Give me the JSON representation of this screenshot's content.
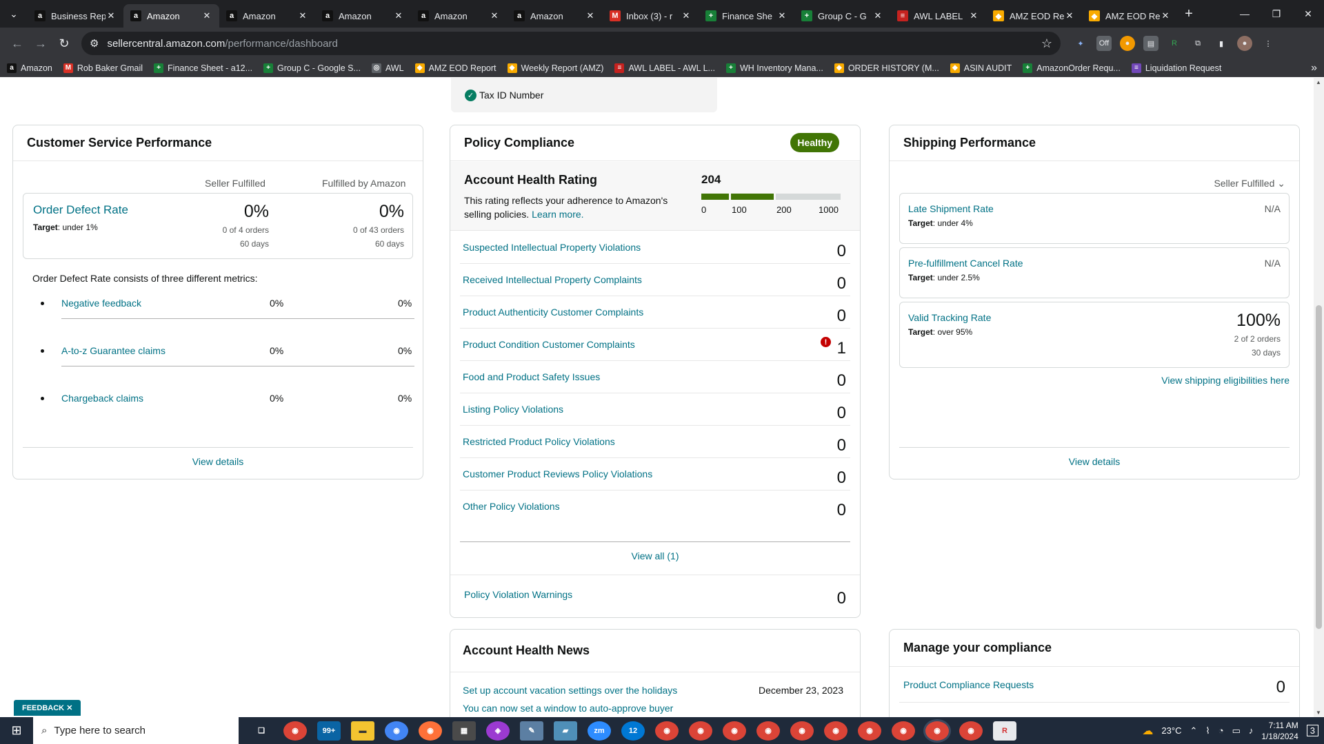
{
  "browser": {
    "tabs": [
      {
        "title": "Business Rep",
        "fav": "a",
        "color": "#111111"
      },
      {
        "title": "Amazon",
        "fav": "a",
        "color": "#111111",
        "active": true
      },
      {
        "title": "Amazon",
        "fav": "a",
        "color": "#111111"
      },
      {
        "title": "Amazon",
        "fav": "a",
        "color": "#111111"
      },
      {
        "title": "Amazon",
        "fav": "a",
        "color": "#111111"
      },
      {
        "title": "Amazon",
        "fav": "a",
        "color": "#111111"
      },
      {
        "title": "Inbox (3) - r",
        "fav": "M",
        "color": "#d93025"
      },
      {
        "title": "Finance She",
        "fav": "+",
        "color": "#188038"
      },
      {
        "title": "Group C - G",
        "fav": "+",
        "color": "#188038"
      },
      {
        "title": "AWL LABEL ",
        "fav": "≡",
        "color": "#c5221f"
      },
      {
        "title": "AMZ EOD Re",
        "fav": "◆",
        "color": "#f9ab00"
      },
      {
        "title": "AMZ EOD Re",
        "fav": "◆",
        "color": "#f9ab00"
      }
    ],
    "url_site": "sellercentral.amazon.com",
    "url_path": "/performance/dashboard",
    "bookmarks": [
      {
        "label": "Amazon",
        "fav": "a",
        "color": "#111111"
      },
      {
        "label": "Rob Baker Gmail",
        "fav": "M",
        "color": "#d93025"
      },
      {
        "label": "Finance Sheet - a12...",
        "fav": "+",
        "color": "#188038"
      },
      {
        "label": "Group C - Google S...",
        "fav": "+",
        "color": "#188038"
      },
      {
        "label": "AWL",
        "fav": "◎",
        "color": "#5f6368"
      },
      {
        "label": "AMZ EOD Report",
        "fav": "◆",
        "color": "#f9ab00"
      },
      {
        "label": "Weekly Report (AMZ)",
        "fav": "◆",
        "color": "#f9ab00"
      },
      {
        "label": "AWL LABEL - AWL L...",
        "fav": "≡",
        "color": "#c5221f"
      },
      {
        "label": "WH Inventory Mana...",
        "fav": "+",
        "color": "#188038"
      },
      {
        "label": "ORDER HISTORY (M...",
        "fav": "◆",
        "color": "#f9ab00"
      },
      {
        "label": "ASIN AUDIT",
        "fav": "◆",
        "color": "#f9ab00"
      },
      {
        "label": "AmazonOrder Requ...",
        "fav": "+",
        "color": "#188038"
      },
      {
        "label": "Liquidation Request",
        "fav": "≡",
        "color": "#7248b9"
      }
    ]
  },
  "tax": {
    "label": "Tax ID Number"
  },
  "customer_service": {
    "title": "Customer Service Performance",
    "col_seller": "Seller Fulfilled",
    "col_fba": "Fulfilled by Amazon",
    "odr": {
      "title": "Order Defect Rate",
      "target_label": "Target",
      "target_value": ": under 1%",
      "seller_pct": "0%",
      "seller_orders": "0 of 4 orders",
      "seller_days": "60 days",
      "fba_pct": "0%",
      "fba_orders": "0 of 43 orders",
      "fba_days": "60 days"
    },
    "desc": "Order Defect Rate consists of three different metrics:",
    "metrics": [
      {
        "name": "Negative feedback",
        "seller": "0%",
        "fba": "0%"
      },
      {
        "name": "A-to-z Guarantee claims",
        "seller": "0%",
        "fba": "0%"
      },
      {
        "name": "Chargeback claims",
        "seller": "0%",
        "fba": "0%"
      }
    ],
    "view_details": "View details"
  },
  "policy": {
    "title": "Policy Compliance",
    "status": "Healthy",
    "status_color": "#417505",
    "ahr": {
      "title": "Account Health Rating",
      "desc": "This rating reflects your adherence to Amazon's selling policies.",
      "learn_more": "Learn more.",
      "score": "204",
      "score_value": 204,
      "ticks": [
        "0",
        "100",
        "200",
        "1000"
      ]
    },
    "rows": [
      {
        "name": "Suspected Intellectual Property Violations",
        "value": "0"
      },
      {
        "name": "Received Intellectual Property Complaints",
        "value": "0"
      },
      {
        "name": "Product Authenticity Customer Complaints",
        "value": "0"
      },
      {
        "name": "Product Condition Customer Complaints",
        "value": "1",
        "alert": true
      },
      {
        "name": "Food and Product Safety Issues",
        "value": "0"
      },
      {
        "name": "Listing Policy Violations",
        "value": "0"
      },
      {
        "name": "Restricted Product Policy Violations",
        "value": "0"
      },
      {
        "name": "Customer Product Reviews Policy Violations",
        "value": "0"
      },
      {
        "name": "Other Policy Violations",
        "value": "0"
      }
    ],
    "view_all": "View all (1)",
    "warnings": {
      "name": "Policy Violation Warnings",
      "value": "0"
    }
  },
  "shipping": {
    "title": "Shipping Performance",
    "dropdown": "Seller Fulfilled",
    "metrics": [
      {
        "name": "Late Shipment Rate",
        "target_label": "Target",
        "target_value": ": under 4%",
        "value": "N/A"
      },
      {
        "name": "Pre-fulfillment Cancel Rate",
        "target_label": "Target",
        "target_value": ": under 2.5%",
        "value": "N/A"
      },
      {
        "name": "Valid Tracking Rate",
        "target_label": "Target",
        "target_value": ": over 95%",
        "value": "100%",
        "orders": "2 of 2 orders",
        "days": "30 days"
      }
    ],
    "eligibility": "View shipping eligibilities here",
    "view_details": "View details"
  },
  "news": {
    "title": "Account Health News",
    "items": [
      {
        "text": "Set up account vacation settings over the holidays",
        "date": "December 23, 2023"
      },
      {
        "text": "You can now set a window to auto-approve buyer",
        "date": ""
      }
    ]
  },
  "compliance": {
    "title": "Manage your compliance",
    "row_name": "Product Compliance Requests",
    "row_value": "0"
  },
  "feedback": "FEEDBACK",
  "taskbar": {
    "search_placeholder": "Type here to search",
    "mail_badge": "99+",
    "zoom_label": "zm",
    "badge_12": "12",
    "temperature": "23°C",
    "time": "7:11 AM",
    "date": "1/18/2024",
    "notif_count": "3"
  }
}
